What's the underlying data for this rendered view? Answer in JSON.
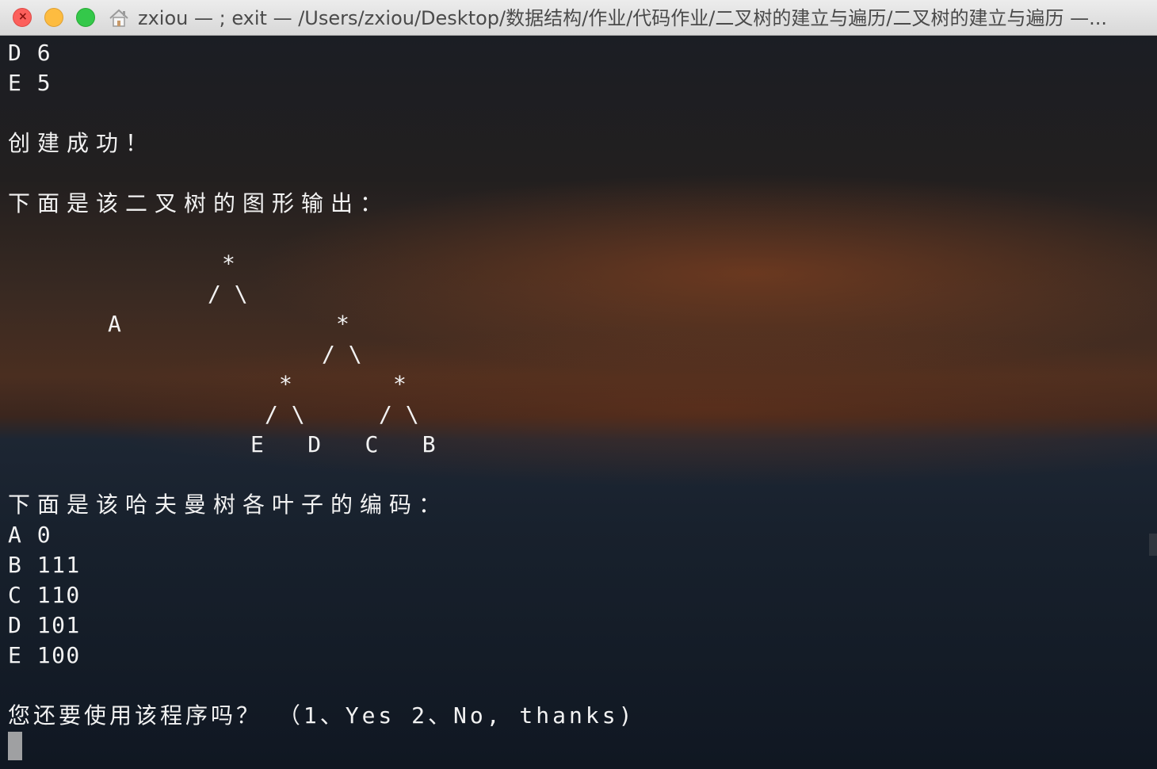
{
  "window": {
    "title": "zxiou — ; exit — /Users/zxiou/Desktop/数据结构/作业/代码作业/二叉树的建立与遍历/二叉树的建立与遍历 —..."
  },
  "icons": {
    "home": "home-icon",
    "close": "close-icon"
  },
  "colors": {
    "close": "#fc605c",
    "minimize": "#fdbc40",
    "maximize": "#34c84a",
    "text": "#f2f2f2"
  },
  "terminal": {
    "input_lines": [
      "D 6",
      "E 5"
    ],
    "success_msg": "创建成功！",
    "graph_header": "下面是该二叉树的图形输出：",
    "tree": {
      "root": "*",
      "root_branches": "/ \\",
      "leaf_a": "A",
      "node_right": "*",
      "node_right_branches": "/ \\",
      "node_left_child": "*",
      "node_right_child": "*",
      "left_child_branches": "/ \\",
      "right_child_branches": "/ \\",
      "leaves_row": "E   D   C   B"
    },
    "code_header": "下面是该哈夫曼树各叶子的编码：",
    "codes": [
      "A 0",
      "B 111",
      "C 110",
      "D 101",
      "E 100"
    ],
    "prompt": "您还要使用该程序吗？ （1、Yes 2、No, thanks)"
  }
}
